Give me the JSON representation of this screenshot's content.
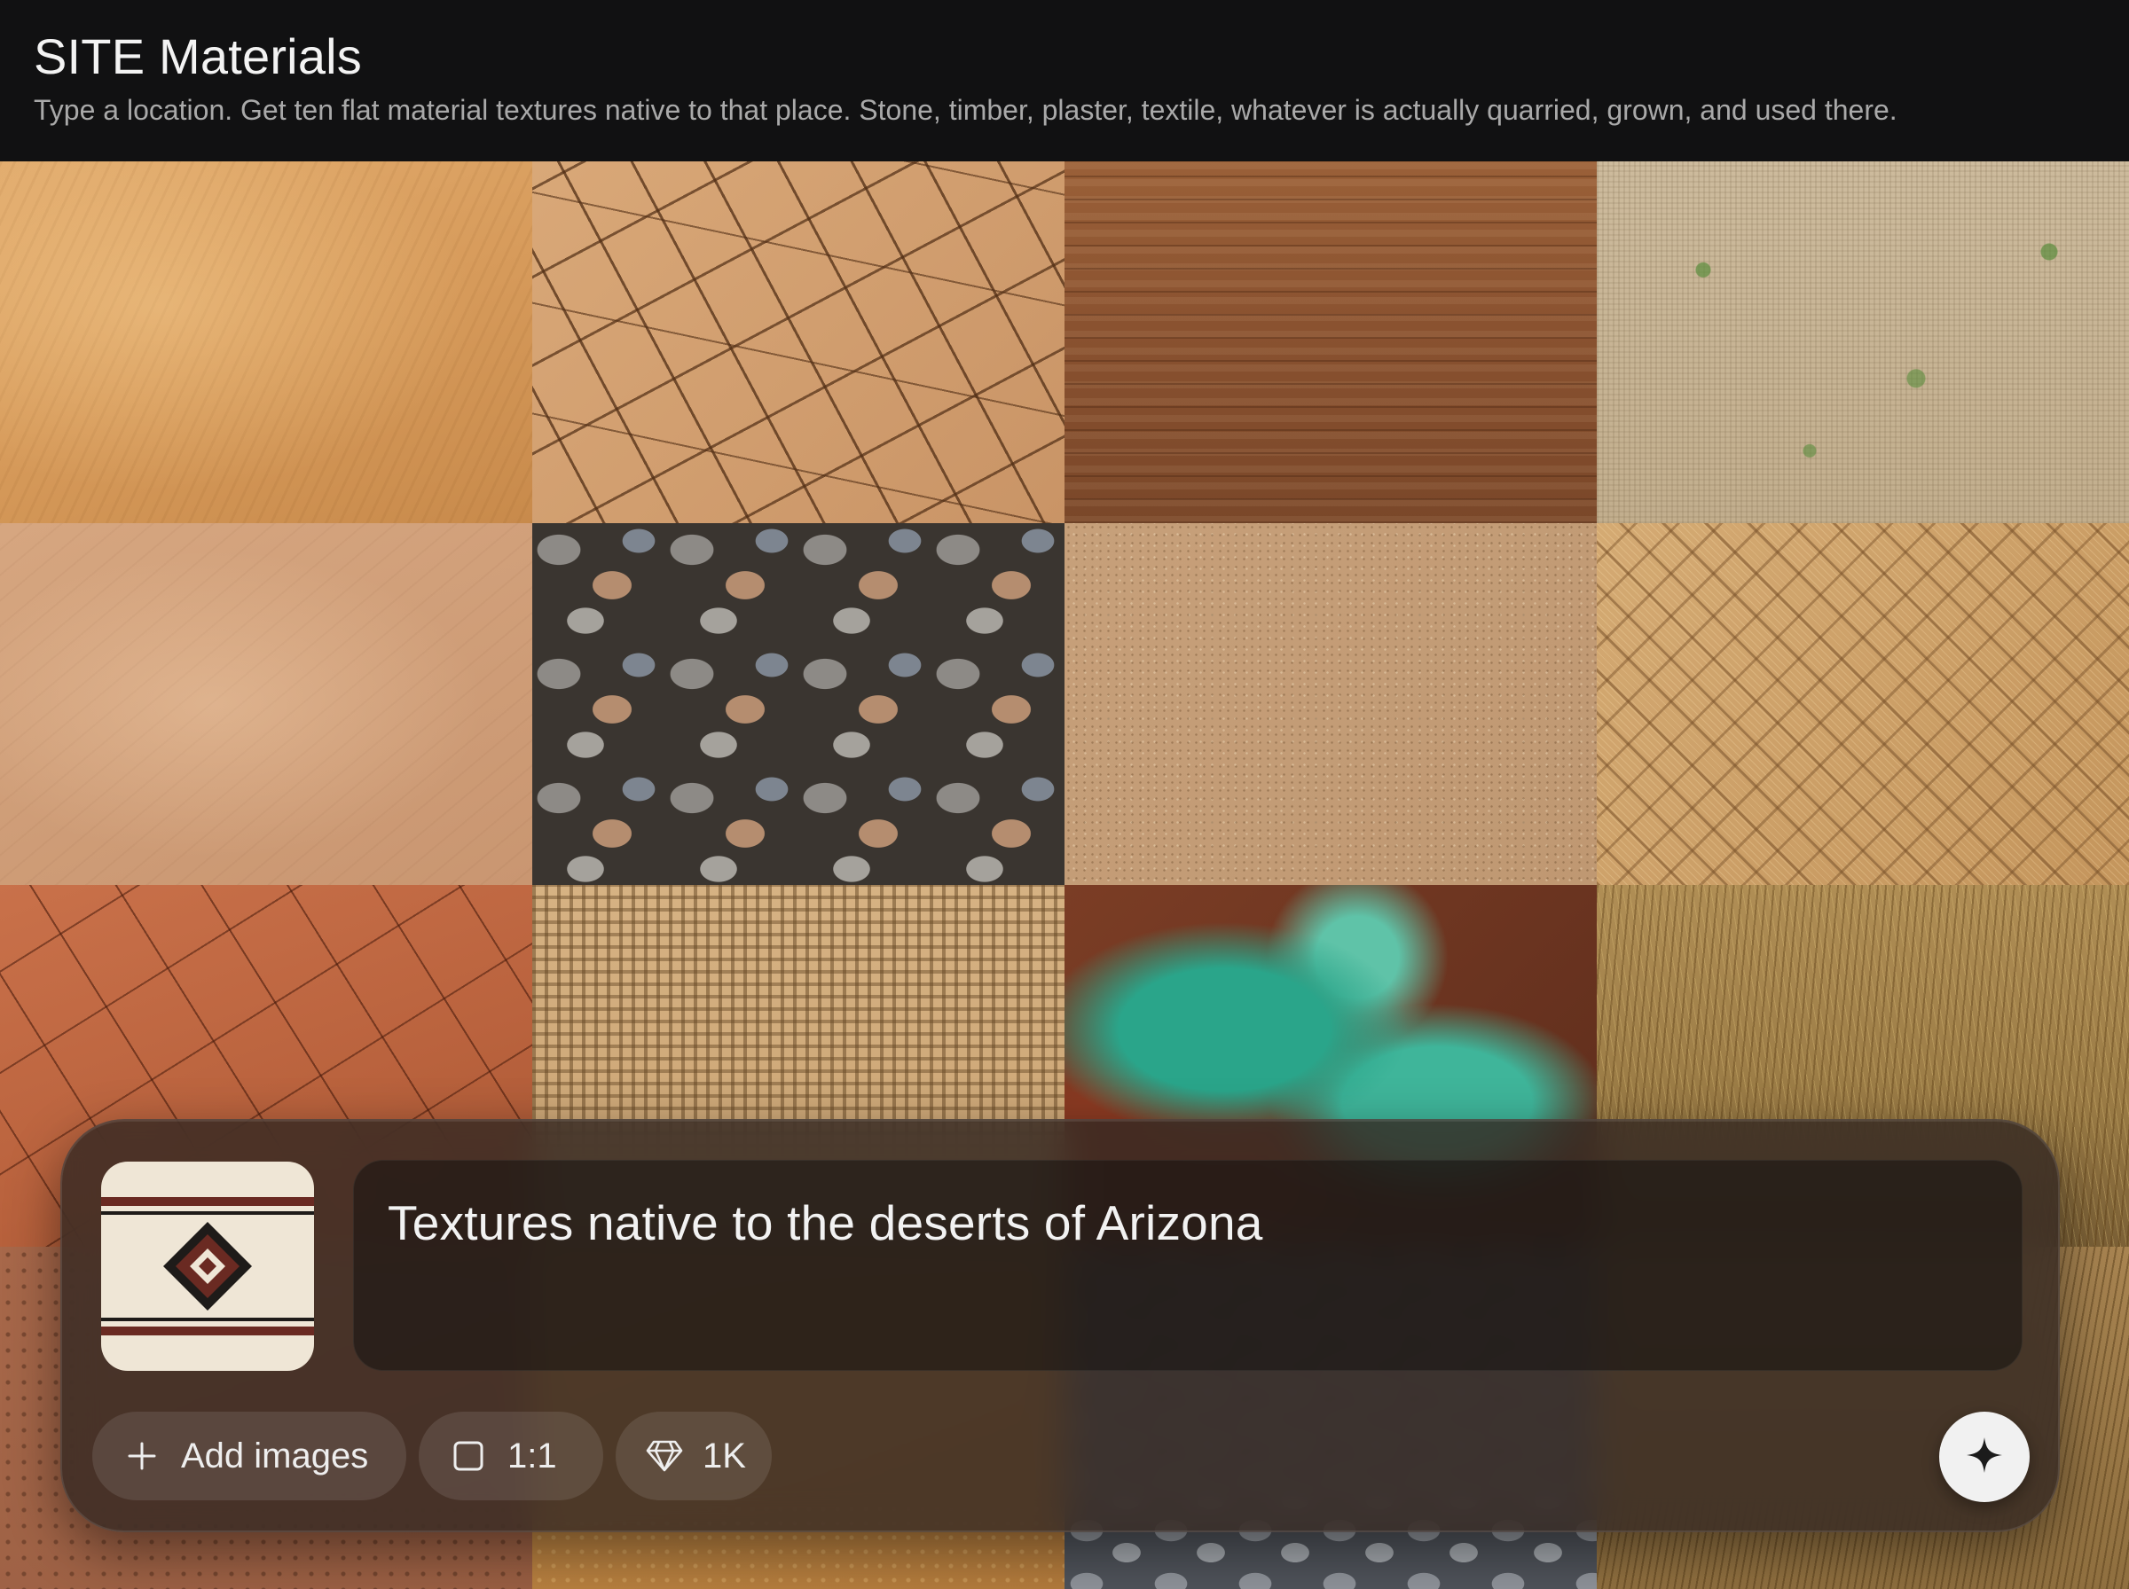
{
  "header": {
    "title": "SITE Materials",
    "subtitle": "Type a location. Get ten flat material textures native to that place. Stone, timber, plaster, textile, whatever is actually quarried, grown, and used there."
  },
  "grid": {
    "tiles": [
      "sandstone",
      "cracked-clay",
      "weathered-wood",
      "burlap-with-leaves",
      "adobe-plaster",
      "river-pebbles",
      "desert-sand",
      "woven-reed",
      "red-cracked-earth",
      "burlap-weave",
      "oxidized-copper",
      "dry-grass",
      "red-dirt",
      "ochre-soil",
      "gray-gravel",
      "dry-grass-2"
    ]
  },
  "composer": {
    "prompt": "Textures native to the deserts of Arizona",
    "thumbnail": "navajo-rug-pattern",
    "add_images_label": "Add images",
    "aspect_ratio_label": "1:1",
    "resolution_label": "1K",
    "icons": {
      "add": "plus-icon",
      "ratio": "square-icon",
      "resolution": "diamond-icon",
      "send": "sparkle-icon"
    }
  },
  "colors": {
    "header_bg": "#111112",
    "composer_bg": "#342822",
    "send_bg": "#f1f1f1"
  }
}
